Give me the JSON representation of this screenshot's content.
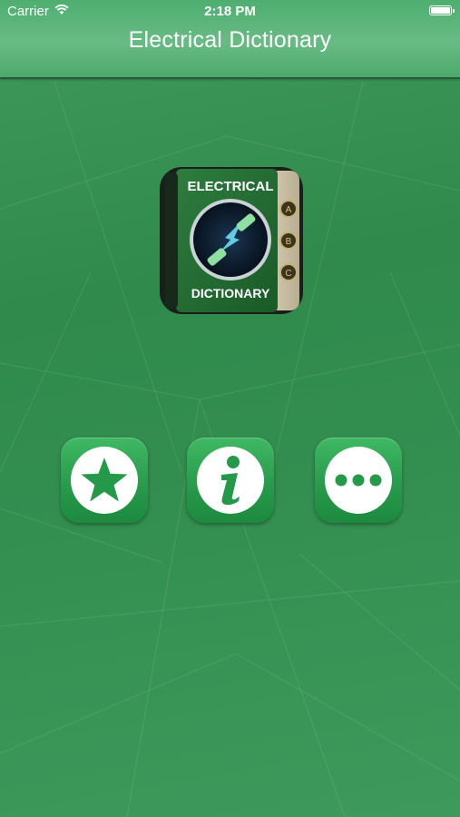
{
  "status_bar": {
    "carrier": "Carrier",
    "time": "2:18 PM",
    "wifi_icon": "wifi-icon",
    "battery_icon": "battery-icon"
  },
  "nav_bar": {
    "title": "Electrical Dictionary"
  },
  "logo": {
    "top_text": "ELECTRICAL",
    "bottom_text": "DICTIONARY",
    "tabs": [
      "A",
      "B",
      "C"
    ]
  },
  "buttons": [
    {
      "icon": "star-icon"
    },
    {
      "icon": "info-icon"
    },
    {
      "icon": "more-icon"
    }
  ],
  "colors": {
    "background": "#2f8a4c",
    "nav_bar": "#5fb57b",
    "button": "#26994a",
    "icon_fg": "#ffffff"
  }
}
